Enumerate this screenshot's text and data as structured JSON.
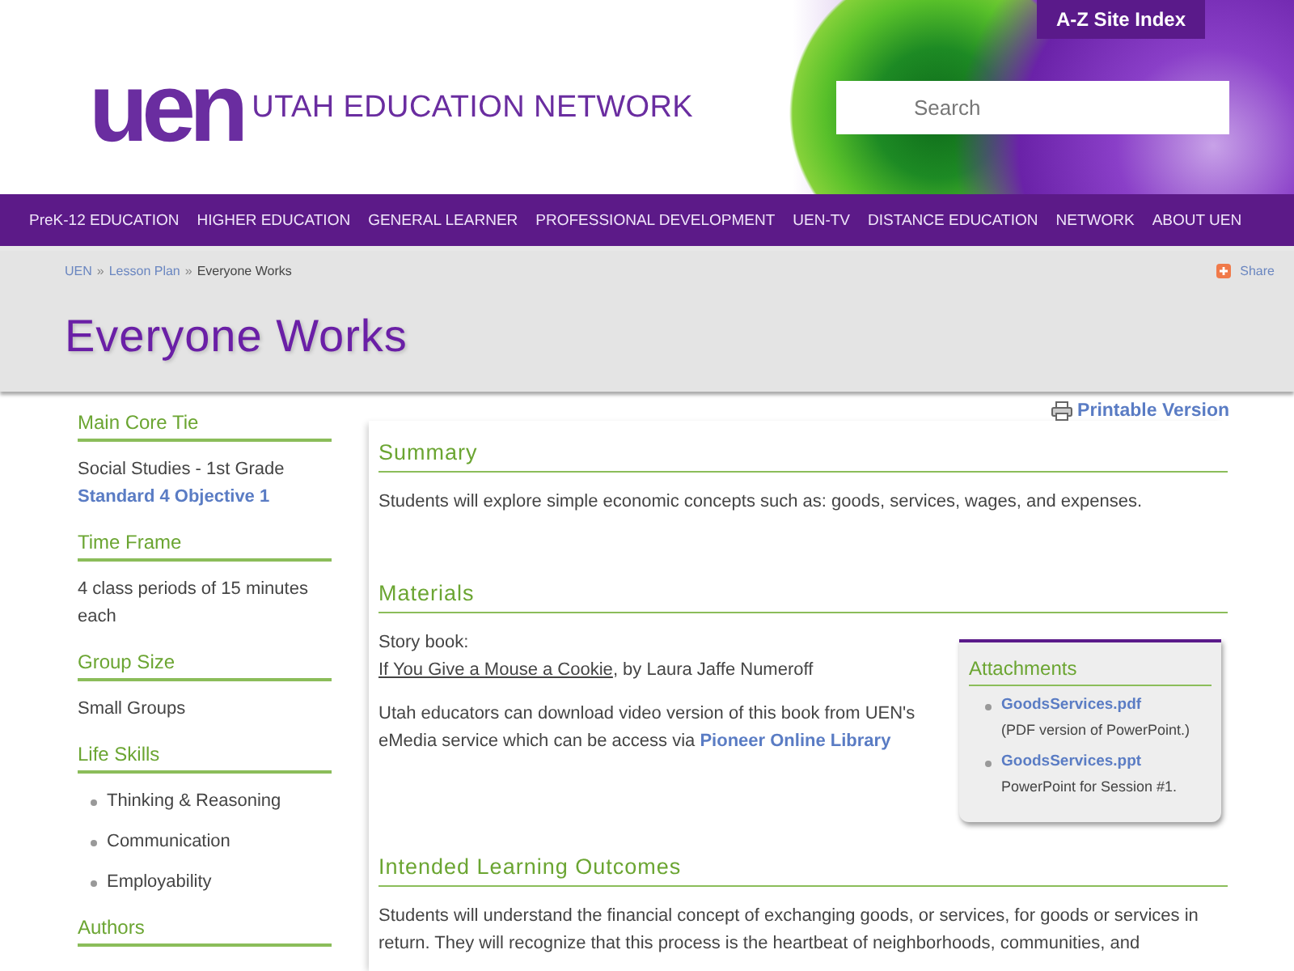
{
  "header": {
    "logo": "uen",
    "site_name": "UTAH EDUCATION NETWORK",
    "az_link": "A-Z Site Index",
    "search": {
      "placeholder": "Search"
    }
  },
  "nav": [
    "PreK-12 EDUCATION",
    "HIGHER EDUCATION",
    "GENERAL LEARNER",
    "PROFESSIONAL DEVELOPMENT",
    "UEN-TV",
    "DISTANCE EDUCATION",
    "NETWORK",
    "ABOUT UEN"
  ],
  "breadcrumb": {
    "separator": "»",
    "items": [
      {
        "label": "UEN",
        "link": true
      },
      {
        "label": "Lesson Plan",
        "link": true
      },
      {
        "label": "Everyone Works",
        "link": false
      }
    ]
  },
  "share": "Share",
  "title": "Everyone Works",
  "printable": "Printable Version",
  "sidebar": [
    {
      "heading": "Main Core Tie",
      "items": [
        {
          "kind": "text",
          "text": "Social Studies - 1st Grade"
        },
        {
          "kind": "link",
          "text": "Standard 4 Objective 1"
        }
      ]
    },
    {
      "heading": "Time Frame",
      "items": [
        {
          "kind": "text",
          "text": "4 class periods of 15 minutes each"
        }
      ]
    },
    {
      "heading": "Group Size",
      "items": [
        {
          "kind": "text",
          "text": "Small Groups"
        }
      ]
    },
    {
      "heading": "Life Skills",
      "items": [
        {
          "kind": "bullet",
          "text": "Thinking & Reasoning"
        },
        {
          "kind": "bullet",
          "text": "Communication"
        },
        {
          "kind": "bullet",
          "text": "Employability"
        }
      ]
    },
    {
      "heading": "Authors"
    }
  ],
  "summary": {
    "heading": "Summary",
    "text": "Students will explore simple economic concepts such as: goods, services, wages, and expenses."
  },
  "materials": {
    "heading": "Materials",
    "intro": "Story book:",
    "book_title": "If You Give a Mouse a Cookie",
    "book_author": ", by Laura Jaffe Numeroff",
    "note": "Utah educators can download video version of this book from UEN's eMedia service which can be access via ",
    "note_link": "Pioneer Online Library"
  },
  "attachments": {
    "heading": "Attachments",
    "items": [
      {
        "file": "GoodsServices.pdf",
        "description": "(PDF version of PowerPoint.)"
      },
      {
        "file": "GoodsServices.ppt",
        "description": "PowerPoint for Session #1."
      }
    ]
  },
  "outcomes": {
    "heading": "Intended Learning Outcomes",
    "text": "Students will understand the financial concept of exchanging goods, or services, for goods or services in return. They will recognize that this process is the heartbeat of neighborhoods, communities, and"
  }
}
